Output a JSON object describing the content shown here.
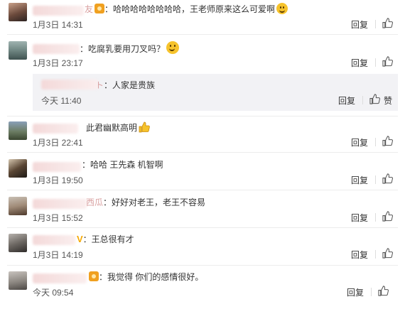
{
  "comments": [
    {
      "id": "c1",
      "name_visible": "友",
      "text": "：哈哈哈哈哈哈哈哈，王老师原来这么可爱啊",
      "time": "1月3日 14:31",
      "reply": "回复"
    },
    {
      "id": "c2",
      "name_visible": "",
      "text": "：吃腐乳要用刀叉吗？",
      "time": "1月3日 23:17",
      "reply": "回复",
      "sub_reply": {
        "name_visible": "ト",
        "text": "：人家是贵族",
        "time": "今天 11:40",
        "reply": "回复",
        "like_label": "赞"
      }
    },
    {
      "id": "c3",
      "name_visible": "",
      "text": "此君幽默高明",
      "time": "1月3日 22:41",
      "reply": "回复"
    },
    {
      "id": "c4",
      "name_visible": "",
      "text": "：哈哈 王先森 机智啊",
      "time": "1月3日 19:50",
      "reply": "回复"
    },
    {
      "id": "c5",
      "name_visible": "西瓜",
      "text": "：好好对老王，老王不容易",
      "time": "1月3日 15:52",
      "reply": "回复"
    },
    {
      "id": "c6",
      "name_visible": "",
      "text": "：王总很有才",
      "time": "1月3日 14:19",
      "reply": "回复"
    },
    {
      "id": "c7",
      "name_visible": "",
      "text": "：我觉得 你们的感情很好。",
      "time": "今天 09:54",
      "reply": "回复"
    }
  ],
  "icons": {
    "like": "thumbs-up-icon",
    "emoji": "smiley-emoji-icon",
    "vip": "vip-badge-icon",
    "thumb_emoji": "thumbs-up-emoji-icon"
  },
  "colors": {
    "name_link": "#d9a0a0",
    "sub_reply_bg": "#f2f2f5",
    "emoji_yellow": "#f6c32c",
    "vip_gold": "#f6a800"
  },
  "vip_mark": "V"
}
